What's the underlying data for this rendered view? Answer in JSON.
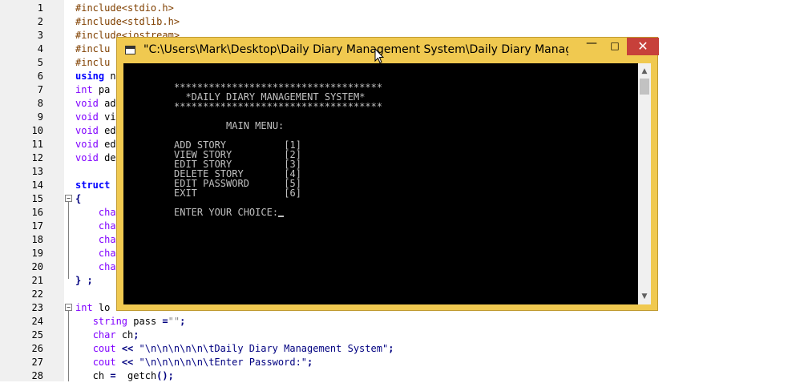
{
  "editor": {
    "lines": [
      {
        "n": "1",
        "parts": [
          [
            "pre",
            "#include<stdio.h>"
          ]
        ]
      },
      {
        "n": "2",
        "parts": [
          [
            "pre",
            "#include<stdlib.h>"
          ]
        ]
      },
      {
        "n": "3",
        "parts": [
          [
            "pre",
            "#include<iostream>"
          ]
        ]
      },
      {
        "n": "4",
        "parts": [
          [
            "pre",
            "#inclu"
          ]
        ]
      },
      {
        "n": "5",
        "parts": [
          [
            "pre",
            "#inclu"
          ]
        ]
      },
      {
        "n": "6",
        "parts": [
          [
            "kw",
            "using"
          ],
          [
            "id",
            " n"
          ]
        ]
      },
      {
        "n": "7",
        "parts": [
          [
            "type",
            "int"
          ],
          [
            "id",
            " pa"
          ]
        ]
      },
      {
        "n": "8",
        "parts": [
          [
            "type",
            "void"
          ],
          [
            "id",
            " ad"
          ]
        ]
      },
      {
        "n": "9",
        "parts": [
          [
            "type",
            "void"
          ],
          [
            "id",
            " vi"
          ]
        ]
      },
      {
        "n": "10",
        "parts": [
          [
            "type",
            "void"
          ],
          [
            "id",
            " ed"
          ]
        ]
      },
      {
        "n": "11",
        "parts": [
          [
            "type",
            "void"
          ],
          [
            "id",
            " ed"
          ]
        ]
      },
      {
        "n": "12",
        "parts": [
          [
            "type",
            "void"
          ],
          [
            "id",
            " de"
          ]
        ]
      },
      {
        "n": "13",
        "parts": []
      },
      {
        "n": "14",
        "parts": [
          [
            "kw",
            "struct"
          ]
        ]
      },
      {
        "n": "15",
        "parts": [
          [
            "op",
            "{"
          ]
        ]
      },
      {
        "n": "16",
        "parts": [
          [
            "id",
            "    "
          ],
          [
            "type",
            "cha"
          ]
        ]
      },
      {
        "n": "17",
        "parts": [
          [
            "id",
            "    "
          ],
          [
            "type",
            "cha"
          ]
        ]
      },
      {
        "n": "18",
        "parts": [
          [
            "id",
            "    "
          ],
          [
            "type",
            "cha"
          ]
        ]
      },
      {
        "n": "19",
        "parts": [
          [
            "id",
            "    "
          ],
          [
            "type",
            "cha"
          ]
        ]
      },
      {
        "n": "20",
        "parts": [
          [
            "id",
            "    "
          ],
          [
            "type",
            "cha"
          ]
        ]
      },
      {
        "n": "21",
        "parts": [
          [
            "op",
            "}"
          ],
          [
            "id",
            " "
          ],
          [
            "op",
            ";"
          ]
        ]
      },
      {
        "n": "22",
        "parts": []
      },
      {
        "n": "23",
        "parts": [
          [
            "type",
            "int"
          ],
          [
            "id",
            " lo"
          ]
        ]
      },
      {
        "n": "24",
        "parts": [
          [
            "id",
            "   "
          ],
          [
            "type",
            "string"
          ],
          [
            "id",
            " pass "
          ],
          [
            "op",
            "="
          ],
          [
            "str",
            "\"\""
          ],
          [
            "op",
            ";"
          ]
        ]
      },
      {
        "n": "25",
        "parts": [
          [
            "id",
            "   "
          ],
          [
            "type",
            "char"
          ],
          [
            "id",
            " ch"
          ],
          [
            "op",
            ";"
          ]
        ]
      },
      {
        "n": "26",
        "parts": [
          [
            "id",
            "   "
          ],
          [
            "type",
            "cout"
          ],
          [
            "id",
            " "
          ],
          [
            "op",
            "<<"
          ],
          [
            "id",
            " "
          ],
          [
            "strb",
            "\"\\n\\n\\n\\n\\n\\tDaily Diary Management System\""
          ],
          [
            "op",
            ";"
          ]
        ]
      },
      {
        "n": "27",
        "parts": [
          [
            "id",
            "   "
          ],
          [
            "type",
            "cout"
          ],
          [
            "id",
            " "
          ],
          [
            "op",
            "<<"
          ],
          [
            "id",
            " "
          ],
          [
            "strb",
            "\"\\n\\n\\n\\n\\n\\tEnter Password:\""
          ],
          [
            "op",
            ";"
          ]
        ]
      },
      {
        "n": "28",
        "parts": [
          [
            "id",
            "   ch "
          ],
          [
            "op",
            "="
          ],
          [
            "id",
            "  getch"
          ],
          [
            "op",
            "();"
          ]
        ]
      }
    ]
  },
  "console": {
    "title": "\"C:\\Users\\Mark\\Desktop\\Daily Diary Management System\\Daily Diary Manage...",
    "minimize_glyph": "—",
    "maximize_glyph": "□",
    "close_glyph": "✕",
    "scroll_up_glyph": "▲",
    "scroll_down_glyph": "▼",
    "output": "************************************\n  *DAILY DIARY MANAGEMENT SYSTEM*\n************************************\n\n         MAIN MENU:\n\nADD STORY          [1]\nVIEW STORY         [2]\nEDIT STORY         [3]\nDELETE STORY       [4]\nEDIT PASSWORD      [5]\nEXIT               [6]\n\nENTER YOUR CHOICE:"
  }
}
